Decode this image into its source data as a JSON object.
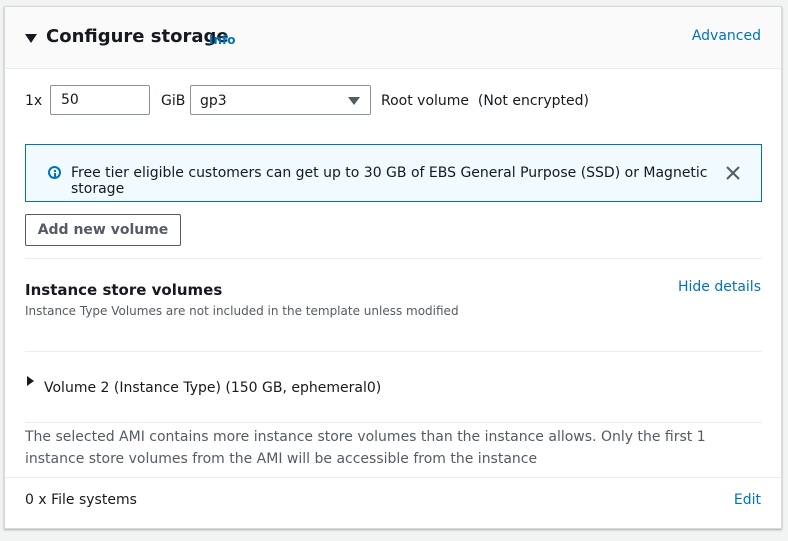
{
  "header": {
    "title": "Configure storage",
    "info_label": "Info",
    "advanced_label": "Advanced"
  },
  "root_volume": {
    "count_label": "1x",
    "size_value": "50",
    "unit_label": "GiB",
    "volume_type": "gp3",
    "description": "Root volume  (Not encrypted)"
  },
  "alert": {
    "message": "Free tier eligible customers can get up to 30 GB of EBS General Purpose (SSD) or Magnetic storage",
    "accent_color": "#0073bb"
  },
  "add_volume_button_label": "Add new volume",
  "instance_store": {
    "title": "Instance store volumes",
    "description": "Instance Type Volumes are not included in the template unless modified",
    "hide_details_label": "Hide details",
    "volumes": [
      {
        "label": "Volume 2 (Instance Type) (150 GB, ephemeral0)"
      }
    ],
    "warning": "The selected AMI contains more instance store volumes than the instance allows. Only the first 1 instance store volumes from the AMI will be accessible from the instance"
  },
  "file_systems": {
    "label": "0 x File systems",
    "edit_label": "Edit"
  },
  "icons": {
    "collapse": "caret-down-icon",
    "info": "info-circle-icon",
    "close": "close-icon",
    "expand": "caret-right-icon",
    "select": "chevron-down-icon"
  },
  "colors": {
    "link": "#0073bb",
    "text": "#16191f",
    "secondary_text": "#545b64"
  }
}
